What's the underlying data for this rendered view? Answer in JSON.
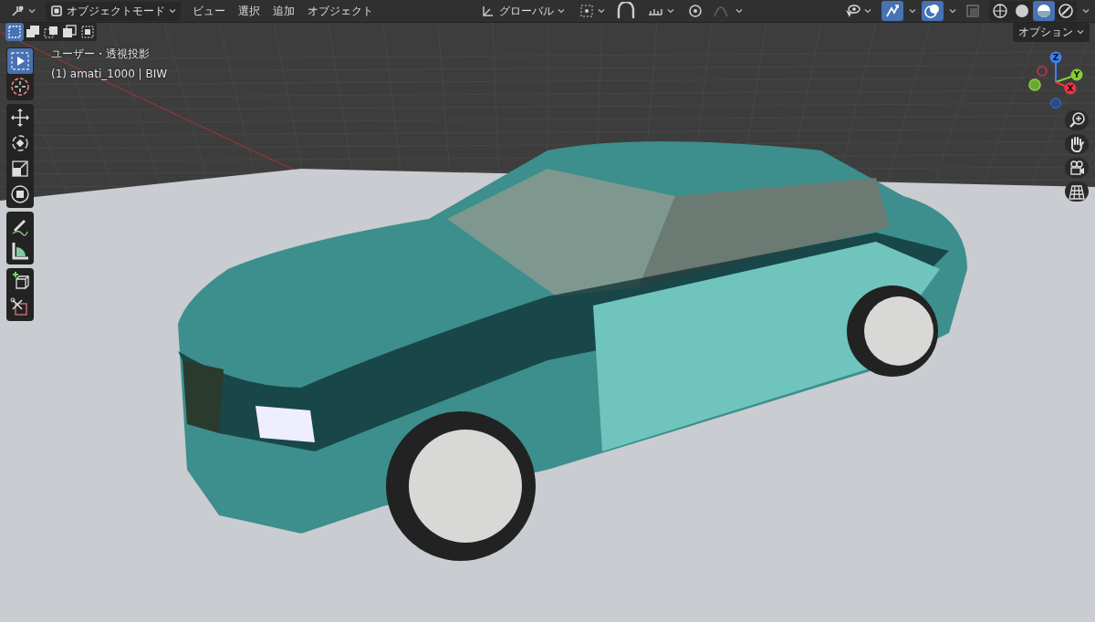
{
  "header": {
    "mode": "オブジェクトモード",
    "menus": [
      "ビュー",
      "選択",
      "追加",
      "オブジェクト"
    ],
    "orientation": "グローバル",
    "toggles": [
      {
        "kind": "snap",
        "on": false
      },
      {
        "kind": "proportional",
        "on": false
      },
      {
        "kind": "gizmo",
        "on": true
      },
      {
        "kind": "overlays",
        "on": true
      },
      {
        "kind": "xray",
        "on": false
      }
    ],
    "shading": [
      {
        "kind": "wireframe",
        "selected": false
      },
      {
        "kind": "solid",
        "selected": false
      },
      {
        "kind": "material",
        "selected": true
      },
      {
        "kind": "rendered",
        "selected": false
      }
    ]
  },
  "tool_settings": {
    "select_modes": [
      {
        "kind": "set",
        "selected": true
      },
      {
        "kind": "extend",
        "selected": false
      },
      {
        "kind": "subtract",
        "selected": false
      },
      {
        "kind": "invert",
        "selected": false
      },
      {
        "kind": "intersect",
        "selected": false
      }
    ],
    "options": "オプション"
  },
  "viewport": {
    "view_name": "ユーザー・透視投影",
    "object_info": "(1) amati_1000 | BIW",
    "tools": [
      {
        "kind": "select",
        "selected": true
      },
      {
        "kind": "cursor",
        "selected": false
      },
      {
        "kind": "move",
        "selected": false
      },
      {
        "kind": "rotate",
        "selected": false
      },
      {
        "kind": "scale",
        "selected": false
      },
      {
        "kind": "transform",
        "selected": false
      },
      {
        "kind": "annotate",
        "selected": false
      },
      {
        "kind": "measure",
        "selected": false
      },
      {
        "kind": "add-cube",
        "selected": false
      },
      {
        "kind": "cut",
        "selected": false
      }
    ],
    "gizmo_axes": [
      "Z",
      "Y",
      "X"
    ],
    "nav_buttons": [
      {
        "kind": "zoom"
      },
      {
        "kind": "pan"
      },
      {
        "kind": "camera"
      },
      {
        "kind": "ortho"
      }
    ]
  }
}
